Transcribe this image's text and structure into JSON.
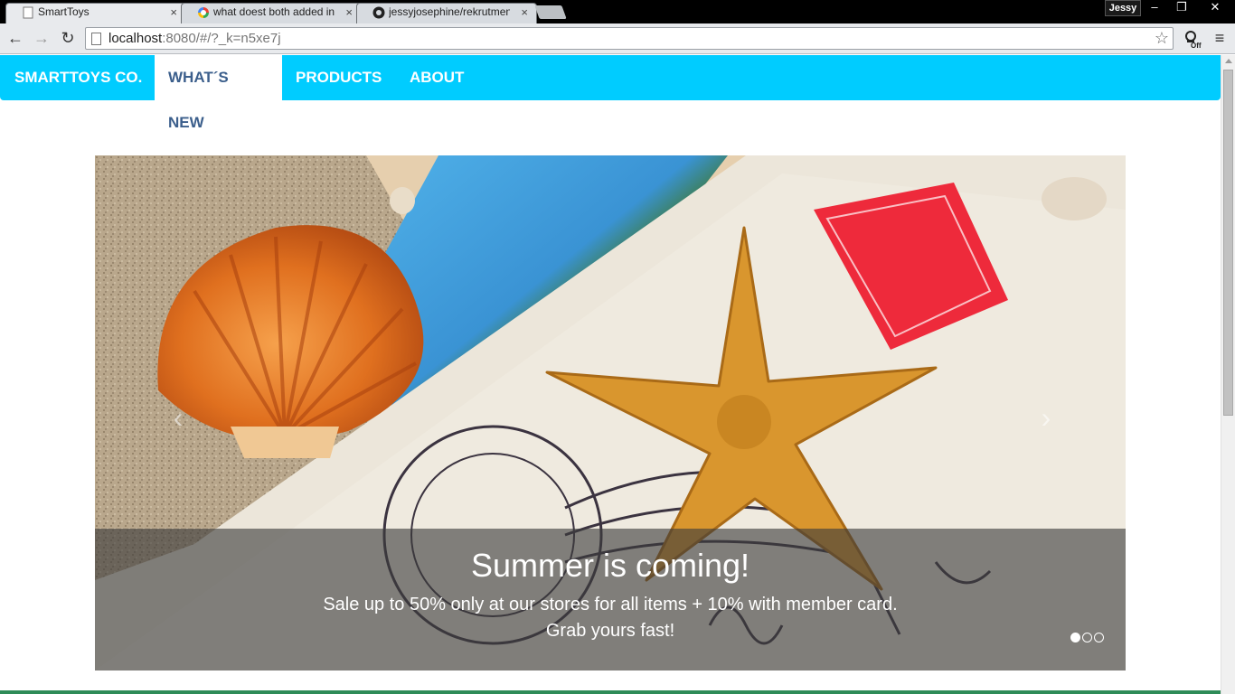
{
  "browser": {
    "tabs": [
      {
        "title": "SmartToys",
        "close": "×",
        "active": true
      },
      {
        "title": "what doest both added in",
        "close": "×",
        "active": false
      },
      {
        "title": "jessyjosephine/rekrutmen",
        "close": "×",
        "active": false
      }
    ],
    "profile_name": "Jessy",
    "window_buttons": {
      "minimize": "–",
      "restore": "❐",
      "close": "✕"
    },
    "nav": {
      "back": "←",
      "forward": "→",
      "reload": "↻"
    },
    "url": {
      "host": "localhost",
      "rest": ":8080/#/?_k=n5xe7j"
    },
    "bookmark_star": "☆",
    "extension_label": "Off",
    "menu_glyph": "≡"
  },
  "navbar": {
    "brand": "SMARTTOYS CO.",
    "items": [
      {
        "label": "WHAT´S NEW",
        "active": true
      },
      {
        "label": "PRODUCTS",
        "active": false
      },
      {
        "label": "ABOUT",
        "active": false
      }
    ]
  },
  "carousel": {
    "prev_glyph": "‹",
    "next_glyph": "›",
    "caption_title": "Summer is coming!",
    "caption_line1": "Sale up to 50% only at our stores for all items + 10% with member card.",
    "caption_line2": "Grab yours fast!",
    "active_slide": 1,
    "slide_count": 3
  },
  "colors": {
    "navbar_bg": "#00ccff",
    "navbar_active_text": "#3c5f8c",
    "caption_bg": "rgba(60,60,60,0.62)"
  }
}
